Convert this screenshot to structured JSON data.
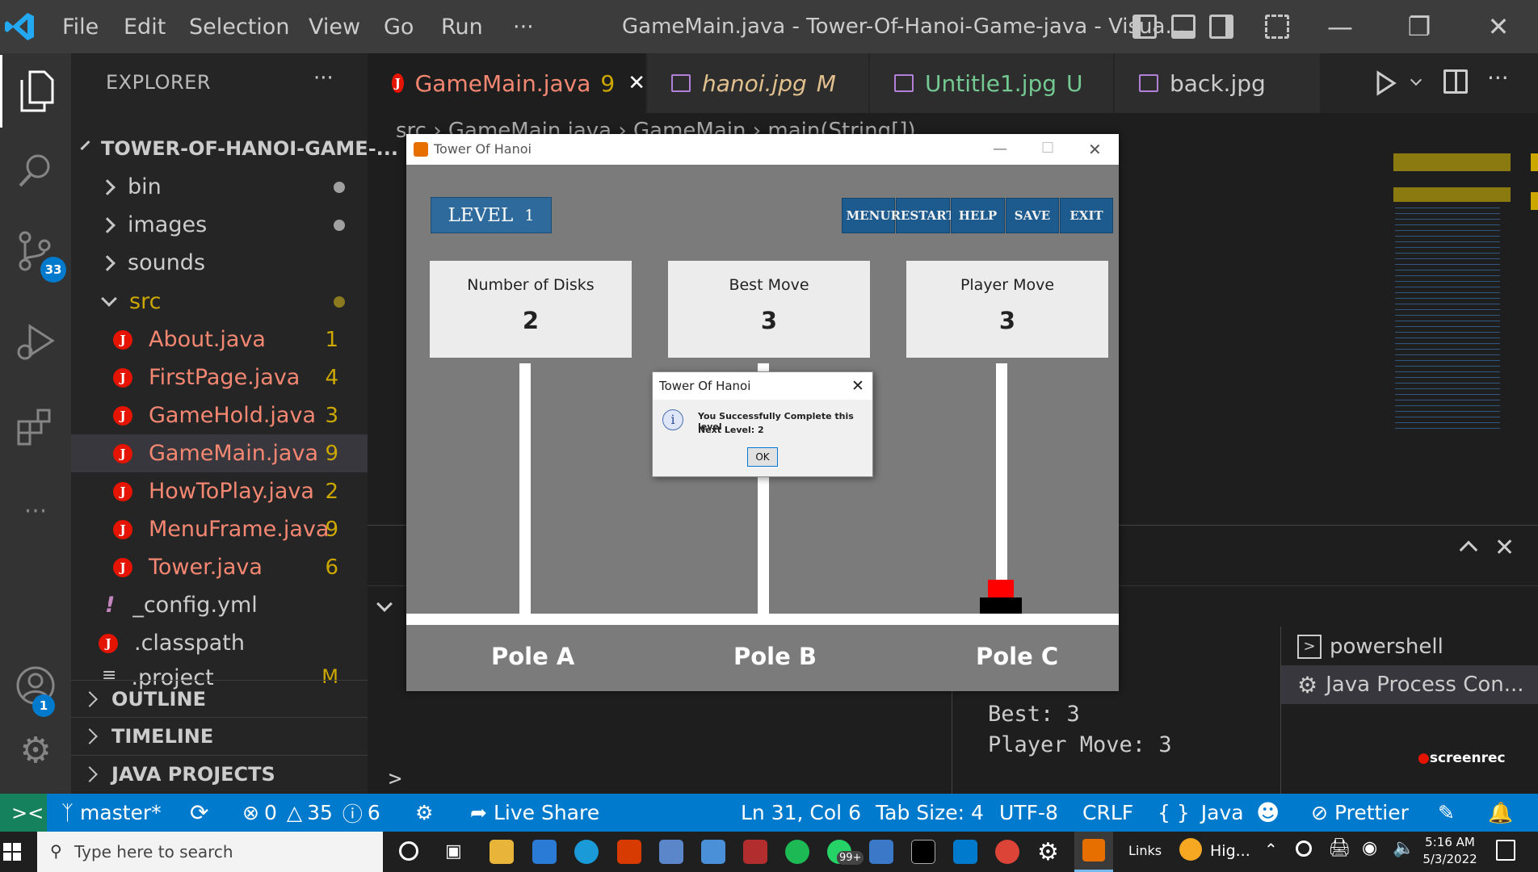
{
  "titlebar": {
    "menu": [
      "File",
      "Edit",
      "Selection",
      "View",
      "Go",
      "Run",
      "···"
    ],
    "title": "GameMain.java - Tower-Of-Hanoi-Game-java - Visua..."
  },
  "activity": {
    "scm_badge": "33",
    "accounts_badge": "1"
  },
  "explorer": {
    "header": "EXPLORER",
    "more": "···",
    "project": "TOWER-OF-HANOI-GAME-...",
    "folders": [
      "bin",
      "images",
      "sounds",
      "src"
    ],
    "files": [
      {
        "name": "About.java",
        "count": "1"
      },
      {
        "name": "FirstPage.java",
        "count": "4"
      },
      {
        "name": "GameHold.java",
        "count": "3"
      },
      {
        "name": "GameMain.java",
        "count": "9"
      },
      {
        "name": "HowToPlay.java",
        "count": "2"
      },
      {
        "name": "MenuFrame.java",
        "count": "9"
      },
      {
        "name": "Tower.java",
        "count": "6"
      }
    ],
    "config": "_config.yml",
    "classpath": ".classpath",
    "project_file": ".project",
    "project_file_status": "M",
    "sections": [
      "OUTLINE",
      "TIMELINE",
      "JAVA PROJECTS"
    ]
  },
  "tabs": [
    {
      "label": "GameMain.java",
      "status": "9"
    },
    {
      "label": "hanoi.jpg",
      "status": "M"
    },
    {
      "label": "Untitle1.jpg",
      "status": "U"
    },
    {
      "label": "back.jpg",
      "status": ""
    }
  ],
  "breadcrumb": "src  ›    GameMain.java  ›    GameMain  ›    main(String[])",
  "terminal": {
    "lines": [
      "Best: 3",
      "Player Move: 3"
    ],
    "prompt": ">",
    "sessions": [
      "powershell",
      "Java Process Con..."
    ],
    "watermark": "screenrec"
  },
  "statusbar": {
    "branch": "master*",
    "errors": "0",
    "warnings": "35",
    "info": "6",
    "live_share": "Live Share",
    "position": "Ln 31, Col 6",
    "tab_size": "Tab Size: 4",
    "encoding": "UTF-8",
    "eol": "CRLF",
    "language": "Java",
    "prettier": "Prettier"
  },
  "taskbar": {
    "search_placeholder": "Type here to search",
    "mail_badge": "99+",
    "links": "Links",
    "weather": "Hig...",
    "time": "5:16 AM",
    "date": "5/3/2022"
  },
  "game": {
    "window_title": "Tower Of Hanoi",
    "level_label": "LEVEL",
    "level": "1",
    "buttons": [
      "MENU",
      "RESTART",
      "HELP",
      "SAVE",
      "EXIT"
    ],
    "boxes": [
      {
        "label": "Number of Disks",
        "value": "2"
      },
      {
        "label": "Best Move",
        "value": "3"
      },
      {
        "label": "Player Move",
        "value": "3"
      }
    ],
    "poles": [
      "Pole A",
      "Pole B",
      "Pole C"
    ],
    "disk_colors": [
      "#ff0000",
      "#000000"
    ]
  },
  "dialog": {
    "title": "Tower Of Hanoi",
    "message1": "You Successfully Complete this level",
    "message2": "Next Level: 2",
    "ok": "OK"
  }
}
